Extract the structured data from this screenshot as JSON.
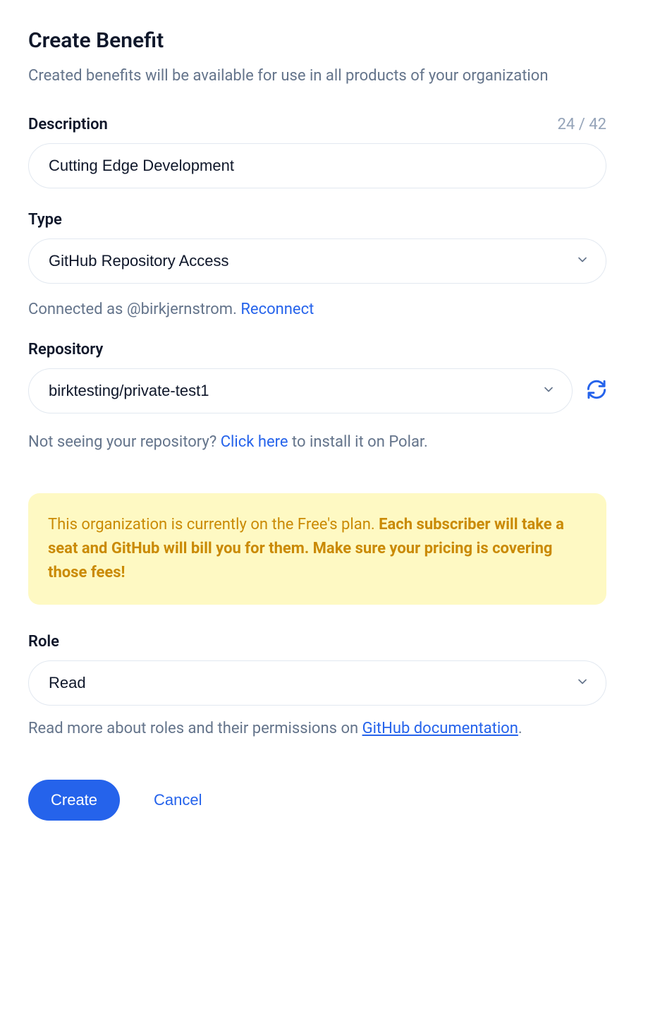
{
  "header": {
    "title": "Create Benefit",
    "subtitle": "Created benefits will be available for use in all products of your organization"
  },
  "description": {
    "label": "Description",
    "char_count": "24 / 42",
    "value": "Cutting Edge Development"
  },
  "type": {
    "label": "Type",
    "value": "GitHub Repository Access"
  },
  "connection": {
    "text_prefix": "Connected as @birkjernstrom. ",
    "reconnect_label": "Reconnect"
  },
  "repository": {
    "label": "Repository",
    "value": "birktesting/private-test1",
    "helper_prefix": "Not seeing your repository? ",
    "helper_link": "Click here",
    "helper_suffix": " to install it on Polar."
  },
  "warning": {
    "text_normal": "This organization is currently on the Free's plan. ",
    "text_bold": "Each subscriber will take a seat and GitHub will bill you for them. Make sure your pricing is covering those fees!"
  },
  "role": {
    "label": "Role",
    "value": "Read",
    "helper_prefix": "Read more about roles and their permissions on ",
    "helper_link": "GitHub documentation",
    "helper_suffix": "."
  },
  "actions": {
    "create_label": "Create",
    "cancel_label": "Cancel"
  }
}
